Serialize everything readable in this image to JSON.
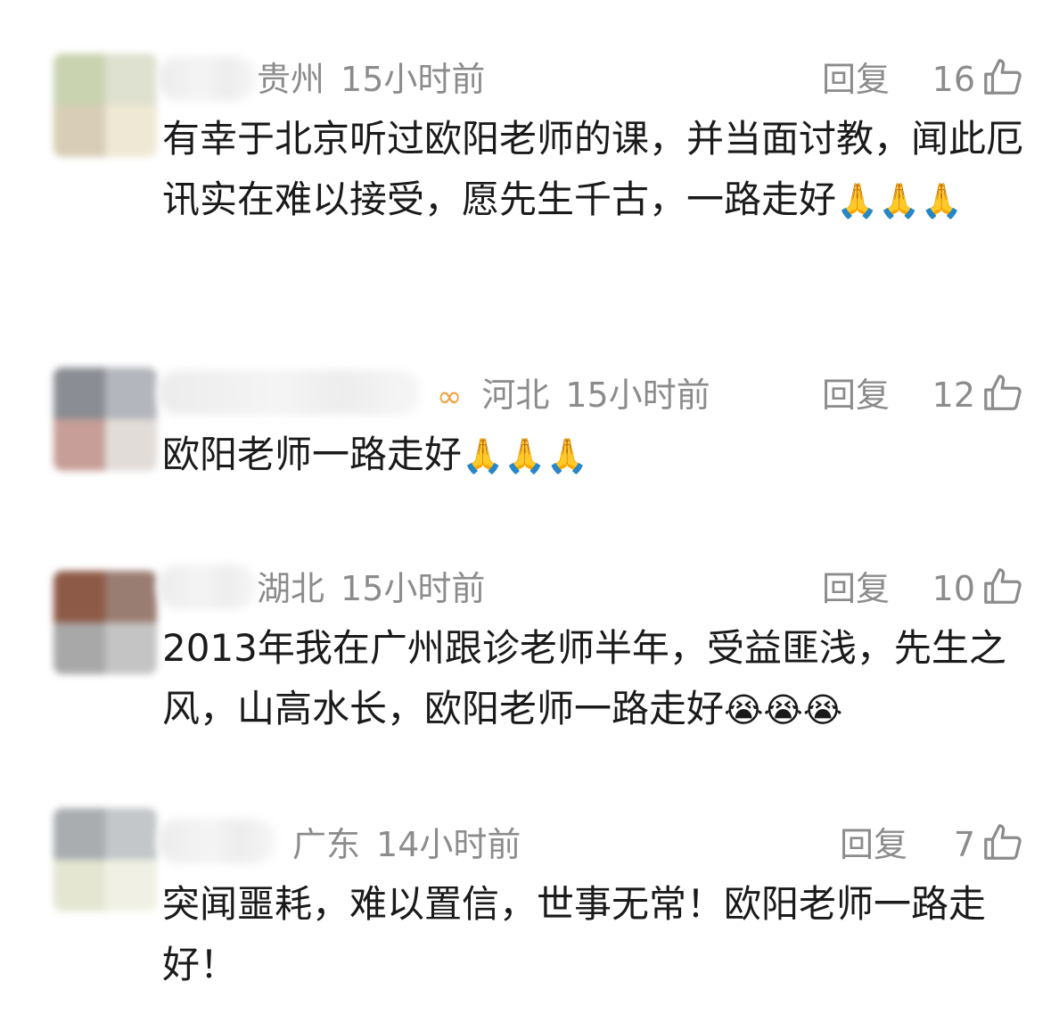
{
  "comments": [
    {
      "location": "贵州",
      "time": "15小时前",
      "reply_label": "回复",
      "likes": "16",
      "text": "有幸于北京听过欧阳老师的课，并当面讨教，闻此厄讯实在难以接受，愿先生千古，一路走好",
      "emojis": "🙏🙏🙏",
      "avatar_colors": [
        "#c9d3b0",
        "#dfe1d0",
        "#d8cdb6",
        "#efe8d4"
      ]
    },
    {
      "badge": "∞",
      "location": "河北",
      "time": "15小时前",
      "reply_label": "回复",
      "likes": "12",
      "text": "欧阳老师一路走好",
      "emojis": "🙏🙏🙏",
      "avatar_colors": [
        "#8a8d93",
        "#b3b6bc",
        "#c79e98",
        "#e2dcd8"
      ]
    },
    {
      "location": "湖北",
      "time": "15小时前",
      "reply_label": "回复",
      "likes": "10",
      "text": "2013年我在广州跟诊老师半年，受益匪浅，先生之风，山高水长，欧阳老师一路走好",
      "emojis": "😭😭😭",
      "avatar_colors": [
        "#8e5a48",
        "#9a7d72",
        "#a8a8a8",
        "#c4c4c4"
      ]
    },
    {
      "location": "广东",
      "time": "14小时前",
      "reply_label": "回复",
      "likes": "7",
      "text": "突闻噩耗，难以置信，世事无常！欧阳老师一路走好！",
      "emojis": "",
      "avatar_colors": [
        "#a9adb0",
        "#c3c7c9",
        "#e4e6d2",
        "#f0f1e4"
      ]
    }
  ]
}
